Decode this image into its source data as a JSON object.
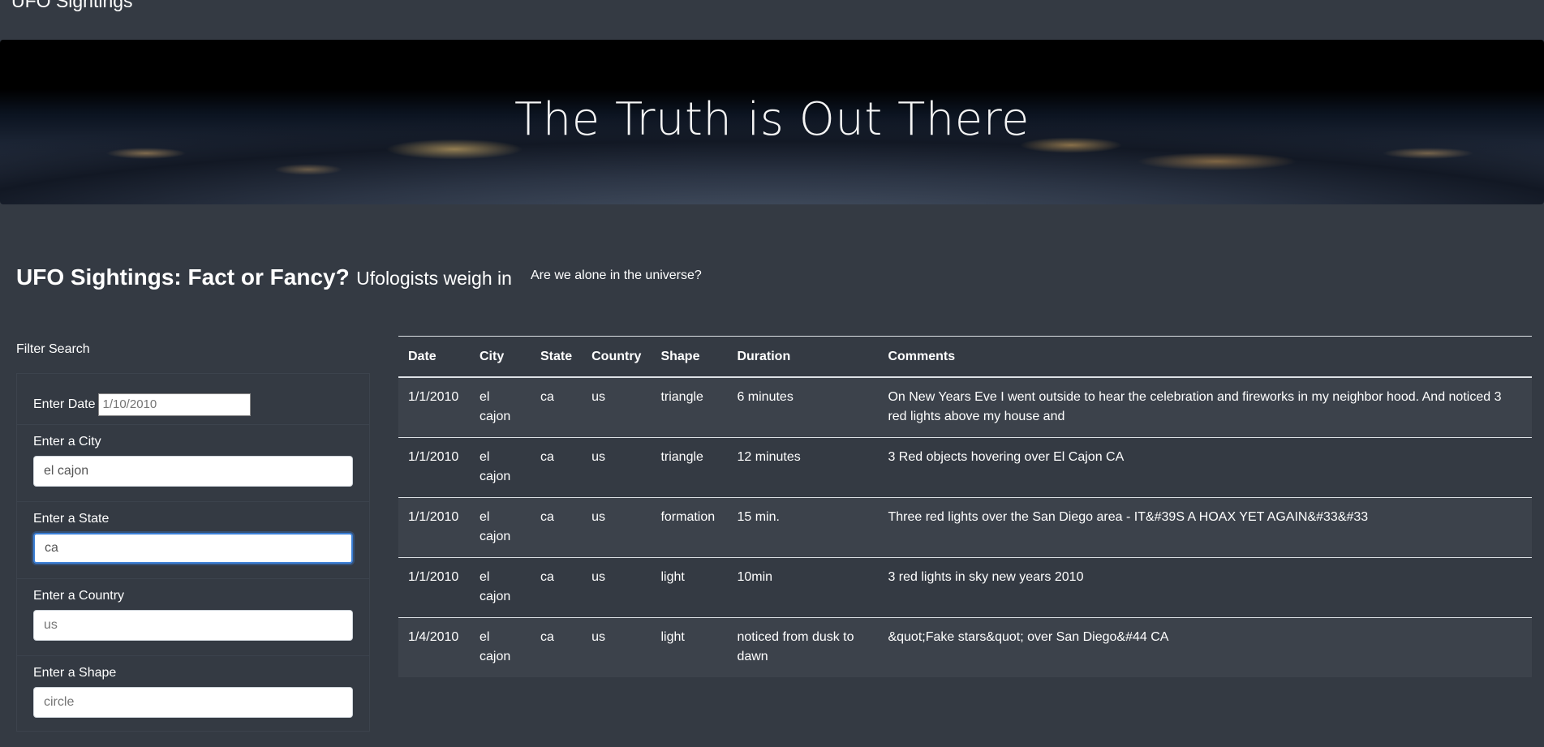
{
  "brand": "UFO Sightings",
  "hero": {
    "title": "The Truth is Out There"
  },
  "heading": {
    "main": "UFO Sightings: Fact or Fancy?",
    "sub": "Ufologists weigh in"
  },
  "tagline": "Are we alone in the universe?",
  "filters": {
    "title": "Filter Search",
    "date": {
      "label": "Enter Date",
      "placeholder": "1/10/2010"
    },
    "city": {
      "label": "Enter a City",
      "value": "el cajon"
    },
    "state": {
      "label": "Enter a State",
      "value": "ca"
    },
    "country": {
      "label": "Enter a Country",
      "placeholder": "us"
    },
    "shape": {
      "label": "Enter a Shape",
      "placeholder": "circle"
    }
  },
  "table": {
    "headers": [
      "Date",
      "City",
      "State",
      "Country",
      "Shape",
      "Duration",
      "Comments"
    ],
    "rows": [
      [
        "1/1/2010",
        "el cajon",
        "ca",
        "us",
        "triangle",
        "6 minutes",
        "On New Years Eve I went outside to hear the celebration and fireworks in my neighbor hood. And noticed 3 red lights above my house and"
      ],
      [
        "1/1/2010",
        "el cajon",
        "ca",
        "us",
        "triangle",
        "12 minutes",
        "3 Red objects hovering over El Cajon CA"
      ],
      [
        "1/1/2010",
        "el cajon",
        "ca",
        "us",
        "formation",
        "15 min.",
        "Three red lights over the San Diego area - IT&#39S A HOAX YET AGAIN&#33&#33"
      ],
      [
        "1/1/2010",
        "el cajon",
        "ca",
        "us",
        "light",
        "10min",
        "3 red lights in sky new years 2010"
      ],
      [
        "1/4/2010",
        "el cajon",
        "ca",
        "us",
        "light",
        "noticed from dusk to dawn",
        "&quot;Fake stars&quot; over San Diego&#44 CA"
      ]
    ]
  }
}
